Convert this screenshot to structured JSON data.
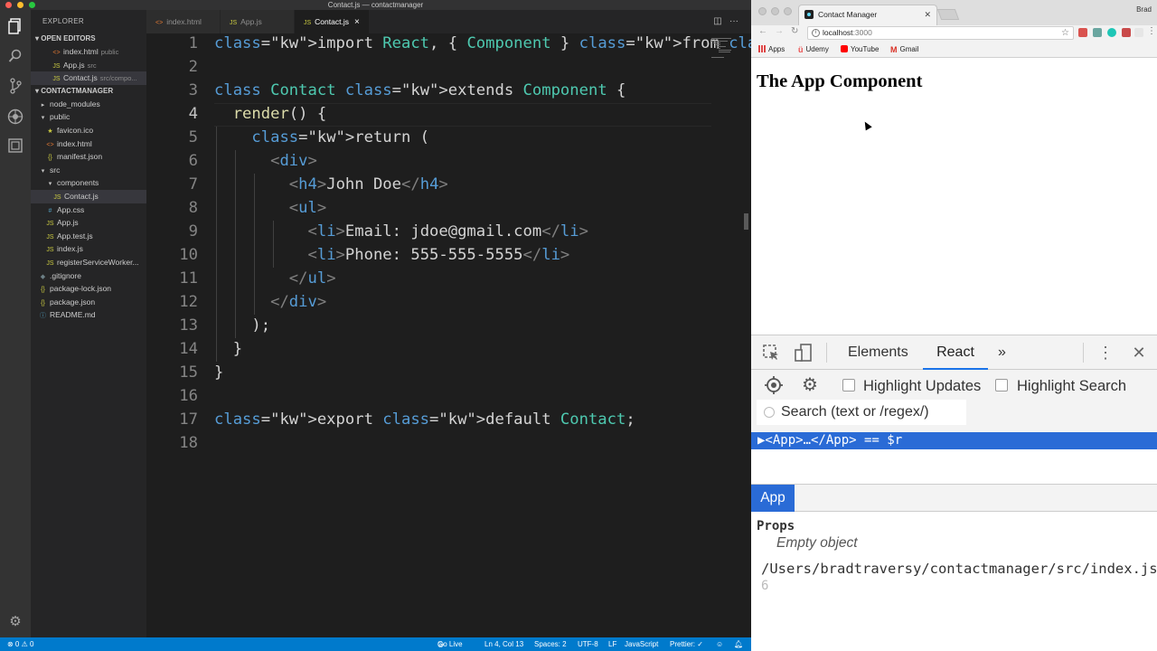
{
  "vscode": {
    "title": "Contact.js — contactmanager",
    "sidebar": {
      "header": "EXPLORER",
      "open_editors_label": "OPEN EDITORS",
      "open_editors": [
        {
          "name": "index.html",
          "hint": "public",
          "type": "html"
        },
        {
          "name": "App.js",
          "hint": "src",
          "type": "js"
        },
        {
          "name": "Contact.js",
          "hint": "src/compo...",
          "type": "js"
        }
      ],
      "project_label": "CONTACTMANAGER",
      "tree": [
        {
          "name": "node_modules",
          "type": "folder-closed"
        },
        {
          "name": "public",
          "type": "folder-open"
        },
        {
          "name": "favicon.ico",
          "type": "fav"
        },
        {
          "name": "index.html",
          "type": "html"
        },
        {
          "name": "manifest.json",
          "type": "json"
        },
        {
          "name": "src",
          "type": "folder-open"
        },
        {
          "name": "components",
          "type": "folder-open"
        },
        {
          "name": "Contact.js",
          "type": "js"
        },
        {
          "name": "App.css",
          "type": "css"
        },
        {
          "name": "App.js",
          "type": "js"
        },
        {
          "name": "App.test.js",
          "type": "js"
        },
        {
          "name": "index.js",
          "type": "js"
        },
        {
          "name": "registerServiceWorker...",
          "type": "js"
        },
        {
          "name": ".gitignore",
          "type": "git"
        },
        {
          "name": "package-lock.json",
          "type": "json"
        },
        {
          "name": "package.json",
          "type": "json"
        },
        {
          "name": "README.md",
          "type": "md"
        }
      ]
    },
    "tabs": [
      {
        "label": "index.html",
        "type": "html"
      },
      {
        "label": "App.js",
        "type": "js"
      },
      {
        "label": "Contact.js",
        "type": "js",
        "active": true
      }
    ],
    "editor": {
      "line_numbers": [
        "1",
        "2",
        "3",
        "4",
        "5",
        "6",
        "7",
        "8",
        "9",
        "10",
        "11",
        "12",
        "13",
        "14",
        "15",
        "16",
        "17",
        "18"
      ],
      "lines": [
        "import React, { Component } from 'react';",
        "",
        "class Contact extends Component {",
        "  render() {",
        "    return (",
        "      <div>",
        "        <h4>John Doe</h4>",
        "        <ul>",
        "          <li>Email: jdoe@gmail.com</li>",
        "          <li>Phone: 555-555-5555</li>",
        "        </ul>",
        "      </div>",
        "    );",
        "  }",
        "}",
        "",
        "export default Contact;",
        ""
      ],
      "current_line": 4
    },
    "statusbar": {
      "problems": "⊗ 0 ⚠ 0",
      "go_live": "Go Live",
      "position": "Ln 4, Col 13",
      "spaces": "Spaces: 2",
      "encoding": "UTF-8",
      "eol": "LF",
      "language": "JavaScript",
      "prettier": "Prettier: ✓"
    }
  },
  "chrome": {
    "tab_title": "Contact Manager",
    "user": "Brad",
    "url_host": "localhost",
    "url_port": ":3000",
    "bookmarks": [
      {
        "label": "Apps"
      },
      {
        "label": "Udemy"
      },
      {
        "label": "YouTube"
      },
      {
        "label": "Gmail"
      }
    ],
    "page_heading": "The App Component",
    "devtools": {
      "tabs": [
        "Elements",
        "React"
      ],
      "active_tab": "React",
      "more": "»",
      "highlight_updates": "Highlight Updates",
      "highlight_search": "Highlight Search",
      "search_placeholder": "Search (text or /regex/)",
      "tree_row": "▶<App>…</App> == $r",
      "side_tab": "App",
      "props_label": "Props",
      "props_value": "Empty object",
      "source_path": "/Users/bradtraversy/contactmanager/src/index.js",
      "source_colon": ":",
      "source_line": "6"
    }
  }
}
